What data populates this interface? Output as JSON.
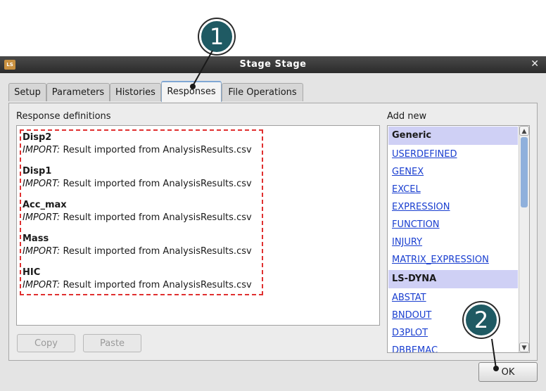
{
  "window": {
    "title": "Stage Stage"
  },
  "tabs": [
    {
      "label": "Setup"
    },
    {
      "label": "Parameters"
    },
    {
      "label": "Histories"
    },
    {
      "label": "Responses"
    },
    {
      "label": "File Operations"
    }
  ],
  "responses": {
    "heading": "Response definitions",
    "items": [
      {
        "name": "Disp2",
        "keyword": "IMPORT:",
        "desc": "Result imported from AnalysisResults.csv"
      },
      {
        "name": "Disp1",
        "keyword": "IMPORT:",
        "desc": "Result imported from AnalysisResults.csv"
      },
      {
        "name": "Acc_max",
        "keyword": "IMPORT:",
        "desc": "Result imported from AnalysisResults.csv"
      },
      {
        "name": "Mass",
        "keyword": "IMPORT:",
        "desc": "Result imported from AnalysisResults.csv"
      },
      {
        "name": "HIC",
        "keyword": "IMPORT:",
        "desc": "Result imported from AnalysisResults.csv"
      }
    ],
    "copy_label": "Copy",
    "paste_label": "Paste"
  },
  "add_new": {
    "heading": "Add new",
    "groups": [
      {
        "title": "Generic",
        "items": [
          "USERDEFINED",
          "GENEX",
          "EXCEL",
          "EXPRESSION",
          "FUNCTION",
          "INJURY",
          "MATRIX_EXPRESSION"
        ]
      },
      {
        "title": "LS-DYNA",
        "items": [
          "ABSTAT",
          "BNDOUT",
          "D3PLOT",
          "DBBEMAC"
        ]
      }
    ]
  },
  "ok_label": "OK",
  "callouts": {
    "one": "1",
    "two": "2"
  },
  "icons": [
    "app-icon",
    "close-icon",
    "scroll-up-icon",
    "scroll-down-icon"
  ]
}
